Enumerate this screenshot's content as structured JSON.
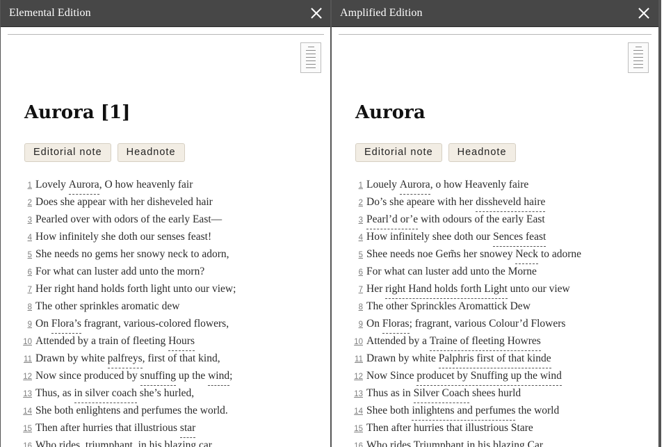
{
  "panes": {
    "left": {
      "title": "Elemental Edition",
      "heading": "Aurora [1]",
      "buttons": [
        "Editorial note",
        "Headnote"
      ],
      "lines": [
        {
          "n": "1",
          "segs": [
            {
              "t": "Lovely "
            },
            {
              "t": "Aurora",
              "u": true
            },
            {
              "t": ", O how heavenly fair"
            }
          ]
        },
        {
          "n": "2",
          "segs": [
            {
              "t": "Does she appear with her disheveled hair"
            }
          ]
        },
        {
          "n": "3",
          "segs": [
            {
              "t": "Pearled over with odors of the early East—"
            }
          ]
        },
        {
          "n": "4",
          "segs": [
            {
              "t": "How infinitely she doth our senses feast!"
            }
          ]
        },
        {
          "n": "5",
          "segs": [
            {
              "t": "She needs no gems her snowy neck to adorn,"
            }
          ]
        },
        {
          "n": "6",
          "segs": [
            {
              "t": "For what can luster add unto the morn?"
            }
          ]
        },
        {
          "n": "7",
          "segs": [
            {
              "t": "Her right hand holds forth light unto our view;"
            }
          ]
        },
        {
          "n": "8",
          "segs": [
            {
              "t": "The other sprinkles aromatic dew"
            }
          ]
        },
        {
          "n": "9",
          "segs": [
            {
              "t": "On "
            },
            {
              "t": "Flora’s",
              "u": true
            },
            {
              "t": " fragrant, various-colored flowers,"
            }
          ]
        },
        {
          "n": "10",
          "segs": [
            {
              "t": "Attended by a train of fleeting "
            },
            {
              "t": "Hours",
              "u": true
            }
          ]
        },
        {
          "n": "11",
          "segs": [
            {
              "t": "Drawn by white "
            },
            {
              "t": "palfreys",
              "u": true
            },
            {
              "t": ", first of that kind,"
            }
          ]
        },
        {
          "n": "12",
          "segs": [
            {
              "t": "Now since produced by "
            },
            {
              "t": "snuffing",
              "u": true
            },
            {
              "t": " up the "
            },
            {
              "t": "wind",
              "u": true
            },
            {
              "t": ";"
            }
          ]
        },
        {
          "n": "13",
          "segs": [
            {
              "t": "Thus, as "
            },
            {
              "t": "in silver coach",
              "u": true
            },
            {
              "t": " she’s hurled,"
            }
          ]
        },
        {
          "n": "14",
          "segs": [
            {
              "t": "She both enlightens and perfumes the world."
            }
          ]
        },
        {
          "n": "15",
          "segs": [
            {
              "t": "Then after hurries that illustrious "
            },
            {
              "t": "star",
              "u": true
            }
          ]
        },
        {
          "n": "16",
          "segs": [
            {
              "t": "Who rides, triumphant, in his "
            },
            {
              "t": "blazing car",
              "u": true
            }
          ]
        }
      ]
    },
    "right": {
      "title": "Amplified Edition",
      "heading": "Aurora",
      "buttons": [
        "Editorial note",
        "Headnote"
      ],
      "lines": [
        {
          "n": "1",
          "segs": [
            {
              "t": "Louely "
            },
            {
              "t": "Aurora",
              "u": true
            },
            {
              "t": ", o how Heavenly faire"
            }
          ]
        },
        {
          "n": "2",
          "segs": [
            {
              "t": "Do’s she apeare with her "
            },
            {
              "t": "dissheveld haire",
              "u": true
            }
          ]
        },
        {
          "n": "3",
          "segs": [
            {
              "t": "Pearl’d or’e",
              "u": true
            },
            {
              "t": " with odours of the early East"
            }
          ]
        },
        {
          "n": "4",
          "segs": [
            {
              "t": "How infinitely shee doth our "
            },
            {
              "t": "Sences feast",
              "u": true
            }
          ]
        },
        {
          "n": "5",
          "segs": [
            {
              "t": "Shee needs noe Gem̃s her snowey "
            },
            {
              "t": "Neck",
              "u": true
            },
            {
              "t": " to adorne"
            }
          ]
        },
        {
          "n": "6",
          "segs": [
            {
              "t": "For what can luster add unto the Morne"
            }
          ]
        },
        {
          "n": "7",
          "segs": [
            {
              "t": "Her "
            },
            {
              "t": "right Hand holds forth Light",
              "u": true
            },
            {
              "t": " unto our view"
            }
          ]
        },
        {
          "n": "8",
          "segs": [
            {
              "t": "The other Sprinckles Aromattick Dew"
            }
          ]
        },
        {
          "n": "9",
          "segs": [
            {
              "t": "On "
            },
            {
              "t": "Floras",
              "u": true
            },
            {
              "t": "; fragrant, various Colour’d Flowers"
            }
          ]
        },
        {
          "n": "10",
          "segs": [
            {
              "t": "Attended by a "
            },
            {
              "t": "Traine of fleeting Howres",
              "u": true
            }
          ]
        },
        {
          "n": "11",
          "segs": [
            {
              "t": "Drawn by white "
            },
            {
              "t": "Palphris first of that kinde",
              "u": true
            }
          ]
        },
        {
          "n": "12",
          "segs": [
            {
              "t": "Now Since "
            },
            {
              "t": "producet by Snuffing up the wind",
              "u": true
            }
          ]
        },
        {
          "n": "13",
          "segs": [
            {
              "t": "Thus as in "
            },
            {
              "t": "Silver Coach",
              "u": true
            },
            {
              "t": " shees hurld"
            }
          ]
        },
        {
          "n": "14",
          "segs": [
            {
              "t": "Shee both "
            },
            {
              "t": "inlightens and perfumes",
              "u": true
            },
            {
              "t": " the world"
            }
          ]
        },
        {
          "n": "15",
          "segs": [
            {
              "t": "Then after hurries that illustrious Stare"
            }
          ]
        },
        {
          "n": "16",
          "segs": [
            {
              "t": "Who rides Triumphant in his "
            },
            {
              "t": "blazing Car",
              "u": true
            }
          ]
        }
      ]
    }
  }
}
